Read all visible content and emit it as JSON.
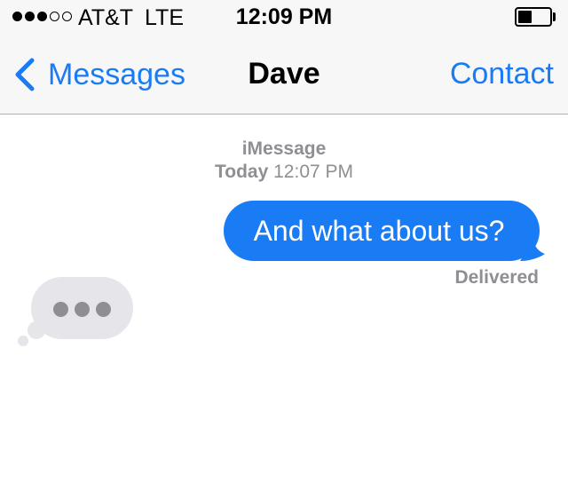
{
  "status_bar": {
    "signal_bars_filled": 3,
    "signal_bars_total": 5,
    "carrier": "AT&T",
    "network": "LTE",
    "time": "12:09 PM",
    "battery_level": 0.45
  },
  "nav": {
    "back_label": "Messages",
    "title": "Dave",
    "contact_label": "Contact"
  },
  "conversation": {
    "service": "iMessage",
    "timestamp_day": "Today",
    "timestamp_time": "12:07 PM",
    "messages": [
      {
        "direction": "sent",
        "text": "And what about us?",
        "status": "Delivered"
      }
    ],
    "typing_indicator": true
  },
  "colors": {
    "accent": "#1a7cf5",
    "sent_bubble": "#1a7cf5",
    "received_bubble": "#e5e5ea",
    "meta_text": "#8e8e93",
    "header_bg": "#f7f7f8"
  },
  "icons": {
    "back": "chevron-left-icon",
    "battery": "battery-icon",
    "signal": "signal-dots-icon",
    "typing": "typing-dots-icon"
  }
}
